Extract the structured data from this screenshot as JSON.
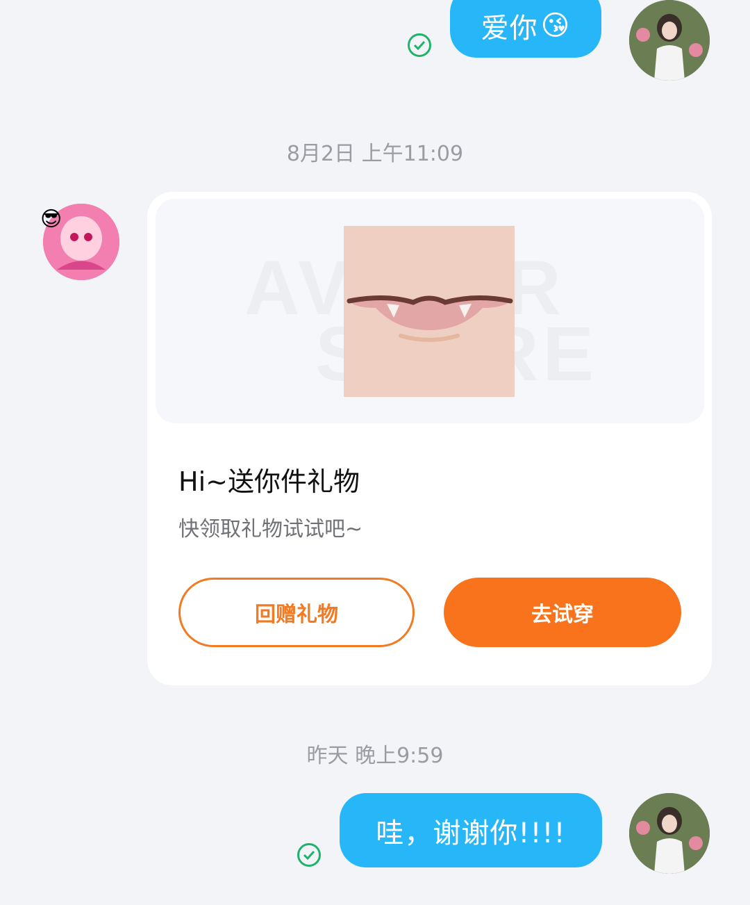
{
  "messages": {
    "first_out": {
      "text": "爱你",
      "emoji": "😘"
    },
    "timestamp_1": "8月2日 上午11:09",
    "gift_card": {
      "title": "Hi~送你件礼物",
      "subtitle": "快领取礼物试试吧~",
      "watermark_line1": "AVATAR",
      "watermark_line2": "STORE",
      "return_gift_label": "回赠礼物",
      "try_on_label": "去试穿"
    },
    "timestamp_2": "昨天 晚上9:59",
    "second_out": {
      "text": "哇，谢谢你!!!!"
    }
  },
  "colors": {
    "bubble_blue": "#27b6f7",
    "accent_orange": "#f8731b",
    "check_green": "#1fb36a"
  }
}
